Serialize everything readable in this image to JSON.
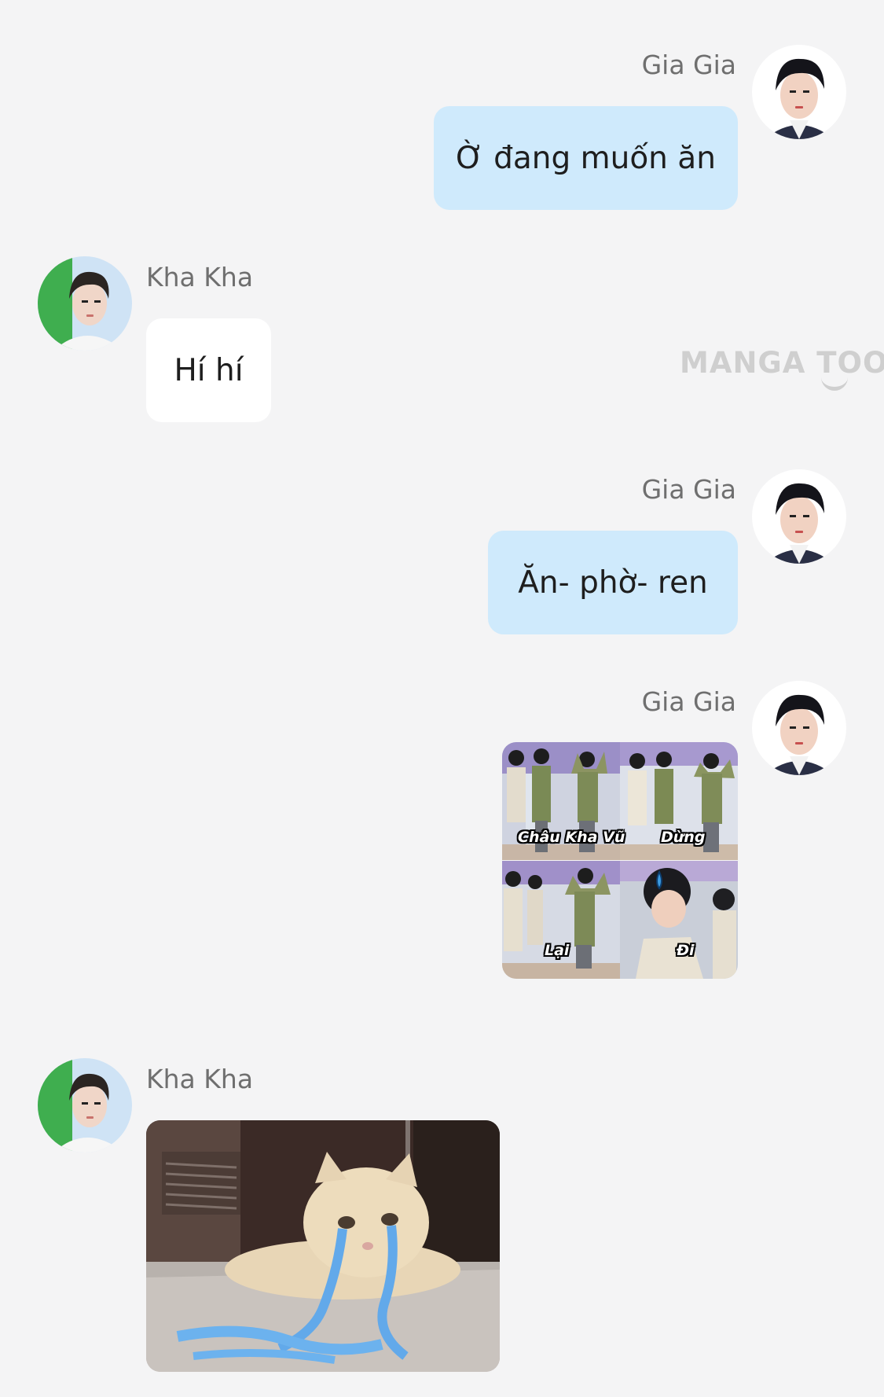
{
  "watermark": "MANGA TOON",
  "messages": [
    {
      "sender": "Gia Gia",
      "side": "right",
      "type": "text",
      "text": "Ờ đang muốn ăn"
    },
    {
      "sender": "Kha Kha",
      "side": "left",
      "type": "text",
      "text": "Hí hí"
    },
    {
      "sender": "Gia Gia",
      "side": "right",
      "type": "text",
      "text": "Ăn- phờ- ren"
    },
    {
      "sender": "Gia Gia",
      "side": "right",
      "type": "image",
      "image": "meme-four-panel-image",
      "captions": [
        "Châu Kha Vũ",
        "Dừng",
        "Lại",
        "Đi"
      ]
    },
    {
      "sender": "Kha Kha",
      "side": "left",
      "type": "image",
      "image": "crying-cat-image"
    }
  ],
  "colors": {
    "background": "#f4f4f5",
    "bubble_right": "#cfeafc",
    "bubble_left": "#ffffff",
    "name_text": "#6f6f6f"
  },
  "icons": {
    "avatar_gia_gia": "avatar-gia-gia-icon",
    "avatar_kha_kha": "avatar-kha-kha-icon"
  }
}
